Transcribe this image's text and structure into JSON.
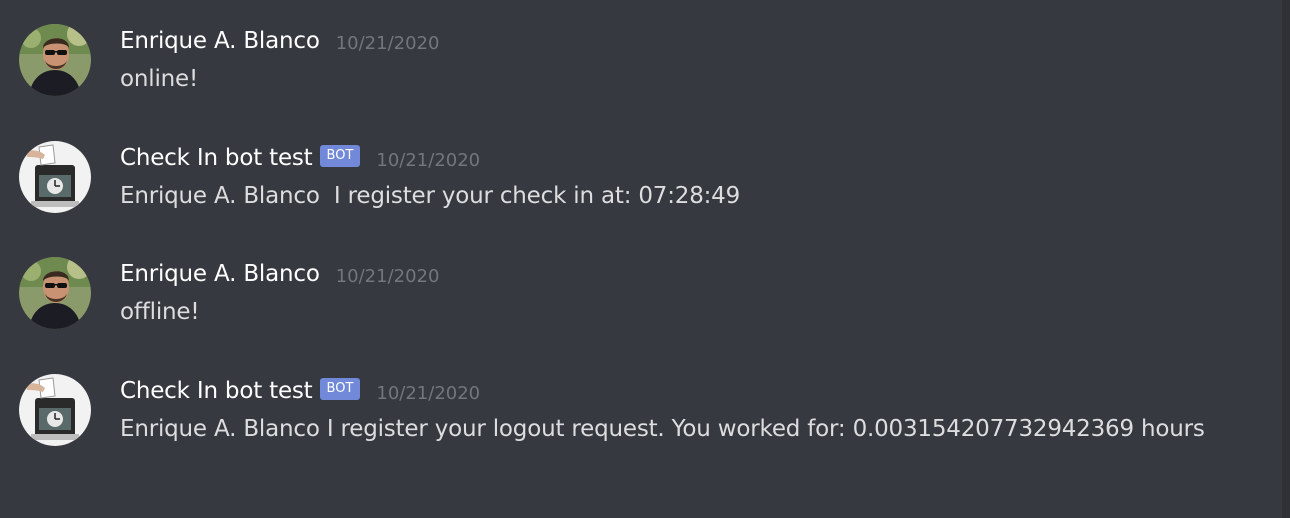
{
  "messages": [
    {
      "username": "Enrique A. Blanco",
      "timestamp": "10/21/2020",
      "text": "online!",
      "avatar": "user-photo-avatar"
    },
    {
      "username": "Check In bot test",
      "badge": "BOT",
      "timestamp": "10/21/2020",
      "text": "Enrique A. Blanco  I register your check in at: 07:28:49",
      "avatar": "time-clock-avatar"
    },
    {
      "username": "Enrique A. Blanco",
      "timestamp": "10/21/2020",
      "text": "offline!",
      "avatar": "user-photo-avatar"
    },
    {
      "username": "Check In bot test",
      "badge": "BOT",
      "timestamp": "10/21/2020",
      "text": "Enrique A. Blanco I register your logout request. You worked for: 0.003154207732942369 hours",
      "avatar": "time-clock-avatar"
    }
  ],
  "colors": {
    "background": "#36393f",
    "username": "#ffffff",
    "message_text": "#dcddde",
    "timestamp": "#72767d",
    "bot_badge": "#7289da"
  }
}
